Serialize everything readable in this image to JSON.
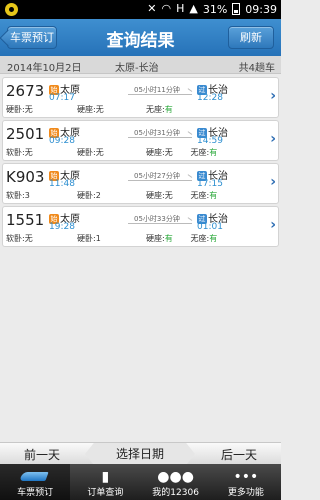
{
  "status_bar": {
    "battery_percent": "31%",
    "time": "09:39",
    "network": "H"
  },
  "header": {
    "back_label": "车票预订",
    "title": "查询结果",
    "refresh_label": "刷新"
  },
  "subheader": {
    "date": "2014年10月2日",
    "route": "太原-长治",
    "count": "共4趟车"
  },
  "badges": {
    "start": "始",
    "pass": "过"
  },
  "trains": [
    {
      "number": "2673",
      "from": "太原",
      "depart": "07:17",
      "duration": "05小时11分钟",
      "to": "长治",
      "arrive": "12:28",
      "seat_a_label": "硬卧:",
      "seat_a_value": "无",
      "seat_b_label": "硬座:",
      "seat_b_value": "无",
      "seat_c_label": "无座:",
      "seat_c_value": "有"
    },
    {
      "number": "2501",
      "from": "太原",
      "depart": "09:28",
      "duration": "05小时31分钟",
      "to": "长治",
      "arrive": "14:59",
      "seat_a_label": "软卧:",
      "seat_a_value": "无",
      "seat_b_label": "硬卧:",
      "seat_b_value": "无",
      "seat_c_label": "硬座:",
      "seat_c_value": "无",
      "seat_d_label": "无座:",
      "seat_d_value": "有"
    },
    {
      "number": "K903",
      "from": "太原",
      "depart": "11:48",
      "duration": "05小时27分钟",
      "to": "长治",
      "arrive": "17:15",
      "seat_a_label": "软卧:",
      "seat_a_value": "3",
      "seat_b_label": "硬卧:",
      "seat_b_value": "2",
      "seat_c_label": "硬座:",
      "seat_c_value": "无",
      "seat_d_label": "无座:",
      "seat_d_value": "有"
    },
    {
      "number": "1551",
      "from": "太原",
      "depart": "19:28",
      "duration": "05小时33分钟",
      "to": "长治",
      "arrive": "01:01",
      "seat_a_label": "软卧:",
      "seat_a_value": "无",
      "seat_b_label": "硬卧:",
      "seat_b_value": "1",
      "seat_c_label": "硬座:",
      "seat_c_value": "有",
      "seat_d_label": "无座:",
      "seat_d_value": "有"
    }
  ],
  "day_nav": {
    "prev": "前一天",
    "pick": "选择日期",
    "next": "后一天"
  },
  "tabs": [
    {
      "label": "车票预订",
      "icon": "train-icon"
    },
    {
      "label": "订单查询",
      "icon": "clipboard-icon"
    },
    {
      "label": "我的12306",
      "icon": "people-icon"
    },
    {
      "label": "更多功能",
      "icon": "more-icon"
    }
  ],
  "colors": {
    "header_blue": "#2a76bb",
    "time_blue": "#2e8fd0",
    "badge_orange": "#f08a1c",
    "available_green": "#2aa83a"
  }
}
